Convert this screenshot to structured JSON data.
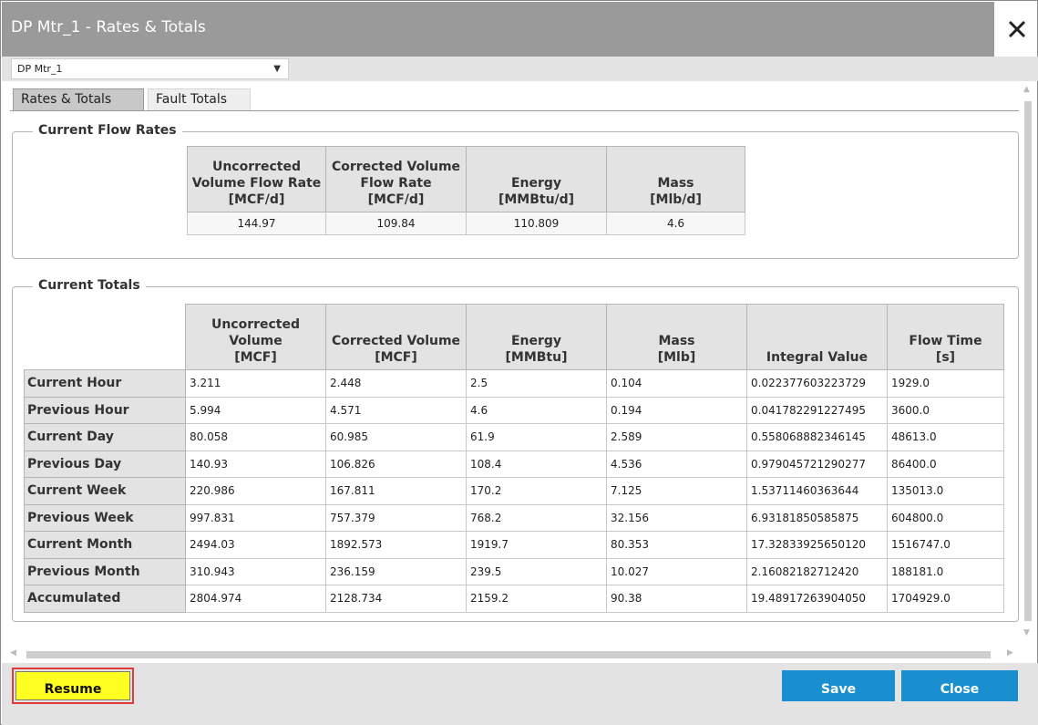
{
  "window": {
    "title": "DP Mtr_1 - Rates & Totals",
    "close_icon": "close-icon"
  },
  "meter_select": {
    "value": "DP Mtr_1",
    "arrow": "▼"
  },
  "tabs": [
    {
      "label": "Rates & Totals",
      "active": true
    },
    {
      "label": "Fault Totals",
      "active": false
    }
  ],
  "flow_rates": {
    "legend": "Current Flow Rates",
    "columns": [
      {
        "line1": "Uncorrected",
        "line2": "Volume Flow Rate",
        "line3": "[MCF/d]"
      },
      {
        "line1": "Corrected Volume",
        "line2": "Flow Rate",
        "line3": "[MCF/d]"
      },
      {
        "line1": "",
        "line2": "Energy",
        "line3": "[MMBtu/d]"
      },
      {
        "line1": "",
        "line2": "Mass",
        "line3": "[Mlb/d]"
      }
    ],
    "values": [
      "144.97",
      "109.84",
      "110.809",
      "4.6"
    ]
  },
  "totals": {
    "legend": "Current Totals",
    "columns": [
      {
        "line1": "Uncorrected",
        "line2": "Volume",
        "line3": "[MCF]"
      },
      {
        "line1": "",
        "line2": "Corrected Volume",
        "line3": "[MCF]"
      },
      {
        "line1": "",
        "line2": "Energy",
        "line3": "[MMBtu]"
      },
      {
        "line1": "",
        "line2": "Mass",
        "line3": "[Mlb]"
      },
      {
        "line1": "",
        "line2": "",
        "line3": "Integral Value"
      },
      {
        "line1": "",
        "line2": "Flow Time",
        "line3": "[s]"
      }
    ],
    "rows": [
      {
        "label": "Current Hour",
        "cells": [
          "3.211",
          "2.448",
          "2.5",
          "0.104",
          "0.022377603223729",
          "1929.0"
        ]
      },
      {
        "label": "Previous Hour",
        "cells": [
          "5.994",
          "4.571",
          "4.6",
          "0.194",
          "0.041782291227495",
          "3600.0"
        ]
      },
      {
        "label": "Current Day",
        "cells": [
          "80.058",
          "60.985",
          "61.9",
          "2.589",
          "0.558068882346145",
          "48613.0"
        ]
      },
      {
        "label": "Previous Day",
        "cells": [
          "140.93",
          "106.826",
          "108.4",
          "4.536",
          "0.979045721290277",
          "86400.0"
        ]
      },
      {
        "label": "Current Week",
        "cells": [
          "220.986",
          "167.811",
          "170.2",
          "7.125",
          "1.53711460363644",
          "135013.0"
        ]
      },
      {
        "label": "Previous Week",
        "cells": [
          "997.831",
          "757.379",
          "768.2",
          "32.156",
          "6.93181850585875",
          "604800.0"
        ]
      },
      {
        "label": "Current Month",
        "cells": [
          "2494.03",
          "1892.573",
          "1919.7",
          "80.353",
          "17.32833925650120",
          "1516747.0"
        ]
      },
      {
        "label": "Previous Month",
        "cells": [
          "310.943",
          "236.159",
          "239.5",
          "10.027",
          "2.16082182712420",
          "188181.0"
        ]
      },
      {
        "label": "Accumulated",
        "cells": [
          "2804.974",
          "2128.734",
          "2159.2",
          "90.38",
          "19.48917263904050",
          "1704929.0"
        ]
      }
    ]
  },
  "footer": {
    "resume_label": "Resume",
    "save_label": "Save",
    "close_label": "Close"
  },
  "colors": {
    "titlebar": "#9a9a9a",
    "resume_button": "#ffff22",
    "resume_highlight": "#e03a3a",
    "primary_button": "#1a8fd0"
  }
}
